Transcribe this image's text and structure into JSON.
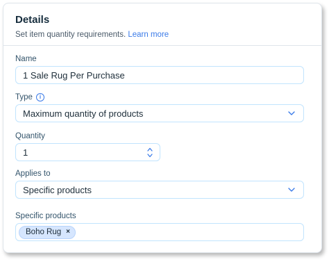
{
  "header": {
    "title": "Details",
    "subtitle": "Set item quantity requirements.",
    "learn_more": "Learn more"
  },
  "fields": {
    "name": {
      "label": "Name",
      "value": "1 Sale Rug Per Purchase"
    },
    "type": {
      "label": "Type",
      "value": "Maximum quantity of products",
      "icon": "info-icon"
    },
    "quantity": {
      "label": "Quantity",
      "value": "1"
    },
    "applies_to": {
      "label": "Applies to",
      "value": "Specific products"
    },
    "specific_products": {
      "label": "Specific products",
      "tags": [
        "Boho Rug"
      ],
      "remove_symbol": "×"
    }
  },
  "colors": {
    "accent": "#3b7be8",
    "input_border": "#c1e4fe",
    "tag_bg": "#d6e6fe",
    "title": "#162d3d"
  }
}
